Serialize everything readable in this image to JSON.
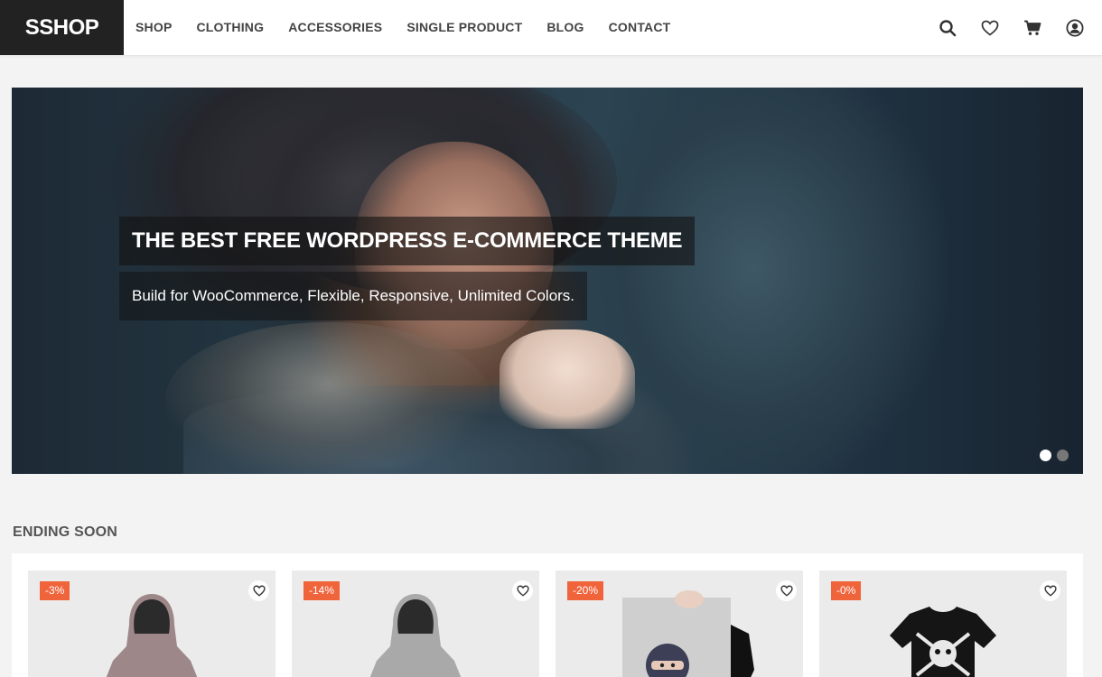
{
  "header": {
    "logo": "SSHOP",
    "nav": [
      "SHOP",
      "CLOTHING",
      "ACCESSORIES",
      "SINGLE PRODUCT",
      "BLOG",
      "CONTACT"
    ],
    "icons": [
      "search-icon",
      "heart-icon",
      "cart-icon",
      "user-icon"
    ]
  },
  "hero": {
    "title": "THE BEST FREE WORDPRESS E-COMMERCE THEME",
    "subtitle": "Build for WooCommerce, Flexible, Responsive, Unlimited Colors.",
    "slides": 2,
    "active_slide": 1
  },
  "ending_soon": {
    "title": "ENDING SOON",
    "products": [
      {
        "badge": "-3%",
        "image": "hoodie-pink"
      },
      {
        "badge": "-14%",
        "image": "hoodie-grey"
      },
      {
        "badge": "-20%",
        "image": "ninja-poster"
      },
      {
        "badge": "-0%",
        "image": "black-tshirt"
      }
    ]
  },
  "colors": {
    "accent": "#f0643c",
    "logo_bg": "#222222",
    "page_bg": "#f3f3f3"
  }
}
